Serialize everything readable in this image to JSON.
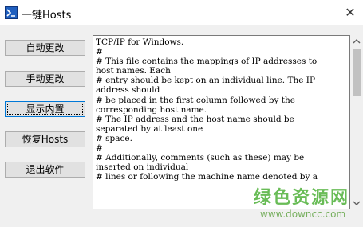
{
  "window": {
    "title": "一键Hosts",
    "icon": "app-icon",
    "close_glyph": "✕"
  },
  "buttons": [
    {
      "label": "自动更改"
    },
    {
      "label": "手动更改"
    },
    {
      "label": "显示内置"
    },
    {
      "label": "恢复Hosts"
    },
    {
      "label": "退出软件"
    }
  ],
  "hosts_text": "TCP/IP for Windows.\n#\n# This file contains the mappings of IP addresses to\nhost names. Each\n# entry should be kept on an individual line. The IP\naddress should\n# be placed in the first column followed by the\ncorresponding host name.\n# The IP address and the host name should be\nseparated by at least one\n# space.\n#\n# Additionally, comments (such as these) may be\ninserted on individual\n# lines or following the machine name denoted by a",
  "watermark": {
    "name": "绿色资源网",
    "url": "www.downcc.com"
  }
}
